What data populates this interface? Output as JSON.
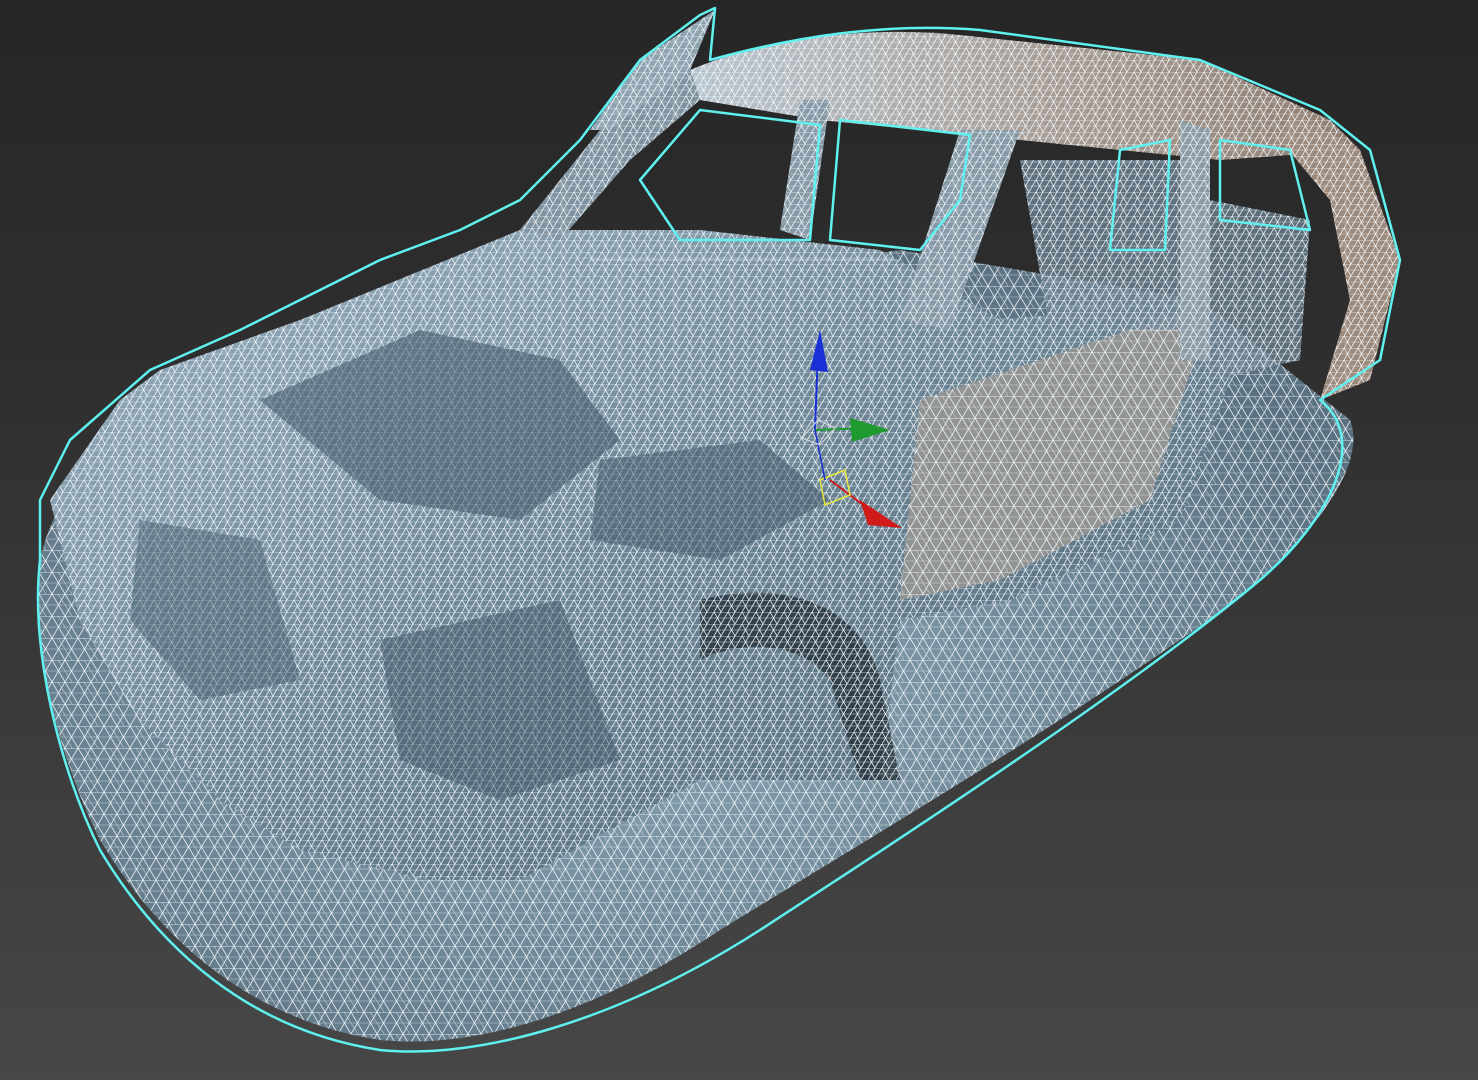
{
  "viewport": {
    "background_top": "#262626",
    "background_bottom": "#474747",
    "selection_outline_color": "#5ff0f0",
    "wire_color": "#eef6fb",
    "mesh_fill_color": "#5f7f92"
  },
  "scene": {
    "object": "wrecked-car-scan-mesh",
    "display_mode": "wireframe-on-shaded",
    "selected": true
  },
  "gizmo": {
    "type": "move-transform",
    "x_axis_color": "#d11a1a",
    "y_axis_color": "#1e9a2e",
    "z_axis_color": "#1b2fd6",
    "plane_color": "#e8e83a"
  }
}
